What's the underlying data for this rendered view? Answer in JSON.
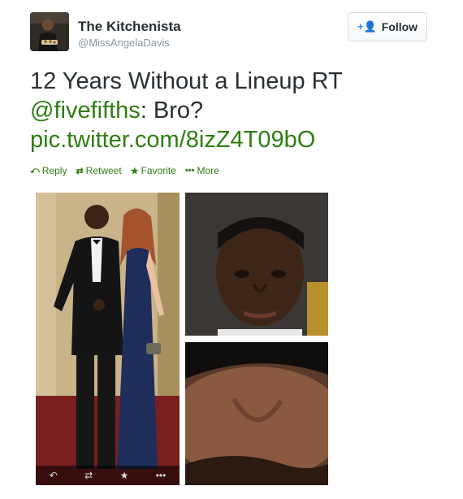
{
  "user": {
    "name": "The Kitchenista",
    "handle": "@MissAngelaDavis"
  },
  "follow_button": {
    "label": "Follow",
    "icon": "add-user-icon"
  },
  "tweet": {
    "line1": "12 Years Without a Lineup RT",
    "mention": "@fivefifths",
    "after_mention": ": Bro?",
    "pic_link": "pic.twitter.com/8izZ4T09bO"
  },
  "actions": [
    {
      "label": "Reply",
      "icon": "reply-icon",
      "glyph": "⤺"
    },
    {
      "label": "Retweet",
      "icon": "retweet-icon",
      "glyph": "⇄"
    },
    {
      "label": "Favorite",
      "icon": "star-icon",
      "glyph": "★"
    },
    {
      "label": "More",
      "icon": "more-icon",
      "glyph": "•••"
    }
  ],
  "photo_bar": {
    "reply_glyph": "↶",
    "retweet_glyph": "⇄",
    "favorite_glyph": "★",
    "more_glyph": "•••"
  },
  "colors": {
    "link": "#2f7d12",
    "meta": "#8899a6",
    "text": "#292f33"
  }
}
